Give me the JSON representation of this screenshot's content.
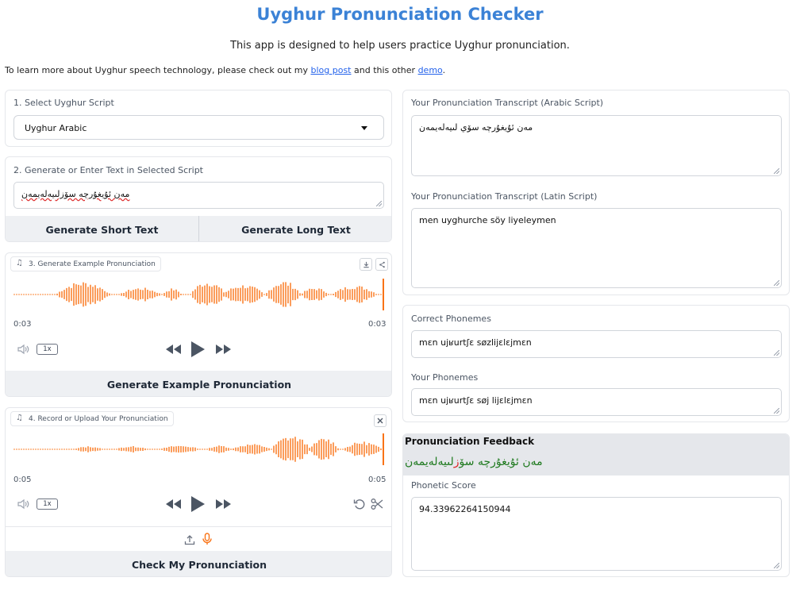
{
  "header": {
    "title": "Uyghur Pronunciation Checker",
    "subtitle": "This app is designed to help users practice Uyghur pronunciation.",
    "intro_prefix": "To learn more about Uyghur speech technology, please check out my ",
    "blog_link": "blog post",
    "intro_middle": " and this other ",
    "demo_link": "demo",
    "intro_suffix": "."
  },
  "script_select": {
    "label": "1. Select Uyghur Script",
    "value": "Uyghur Arabic"
  },
  "text_input": {
    "label": "2. Generate or Enter Text in Selected Script",
    "value": "مەن ئۇيغۇرچە سۆزلىيەلەيمەن",
    "short_button": "Generate Short Text",
    "long_button": "Generate Long Text"
  },
  "example_audio": {
    "tag": "3. Generate Example Pronunciation",
    "time_current": "0:03",
    "time_total": "0:03",
    "speed": "1x",
    "button": "Generate Example Pronunciation"
  },
  "user_audio": {
    "tag": "4. Record or Upload Your Pronunciation",
    "time_current": "0:05",
    "time_total": "0:05",
    "speed": "1x",
    "button": "Check My Pronunciation"
  },
  "transcripts": {
    "arabic_label": "Your Pronunciation Transcript (Arabic Script)",
    "arabic_value": "مەن ئۇيغۇرچە سۆي لىيەلەيمەن",
    "latin_label": "Your Pronunciation Transcript (Latin Script)",
    "latin_value": "men uyghurche söy liyeleymen"
  },
  "phonemes": {
    "correct_label": "Correct Phonemes",
    "correct_value": "mɛn ujʁurtʃɛ søzlijɛlɛjmɛn",
    "yours_label": "Your Phonemes",
    "yours_value": "mɛn ujʁurtʃɛ søj lijɛlɛjmɛn"
  },
  "feedback": {
    "title": "Pronunciation Feedback",
    "text_before": "مەن ئۇيغۇرچە سۆ",
    "text_error": "ز",
    "text_after": "لىيەلەيمەن",
    "score_label": "Phonetic Score",
    "score_value": "94.33962264150944"
  },
  "colors": {
    "accent": "#3b82d6",
    "waveform": "#f97316",
    "correct": "#1f7a1f",
    "error": "#dc2626"
  }
}
